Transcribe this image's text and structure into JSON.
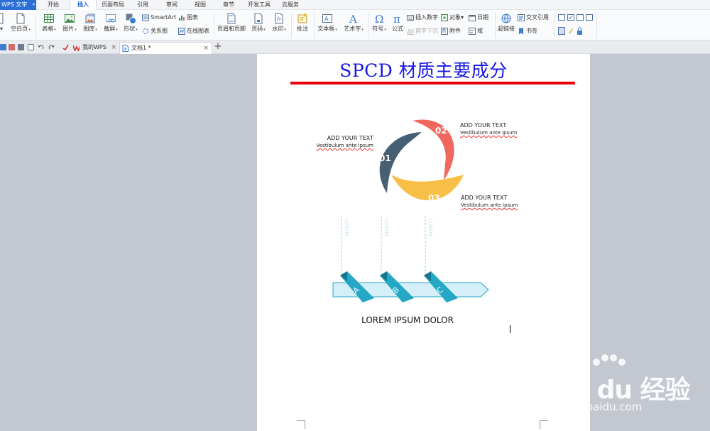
{
  "app": {
    "name": "WPS 文字",
    "menu_caret": "▾"
  },
  "menu": {
    "tabs": [
      {
        "label": "开始"
      },
      {
        "label": "插入"
      },
      {
        "label": "页面布局"
      },
      {
        "label": "引用"
      },
      {
        "label": "审阅"
      },
      {
        "label": "视图"
      },
      {
        "label": "章节"
      },
      {
        "label": "开发工具"
      },
      {
        "label": "云服务"
      }
    ]
  },
  "ribbon": {
    "blank_page": "空白页",
    "table": "表格",
    "picture": "图片",
    "gallery": "图库",
    "screenshot": "截屏",
    "shapes": "形状",
    "smartart": "SmartArt",
    "chart": "图表",
    "relationship": "关系图",
    "online_chart": "在线图表",
    "header_footer": "页眉和页脚",
    "page_number": "页码",
    "watermark": "水印",
    "comment": "批注",
    "textbox": "文本框",
    "wordart": "艺术字",
    "symbol": "符号",
    "formula": "公式",
    "insert_number": "插入数字",
    "drop_cap": "首字下沉",
    "object": "对象",
    "attachment": "附件",
    "date": "日期",
    "field": "域",
    "hyperlink": "超链接",
    "cross_ref": "交叉引用",
    "bookmark": "书签",
    "caret": "▾"
  },
  "tabs": {
    "items": [
      {
        "label": "我的WPS",
        "close": "×"
      },
      {
        "label": "文档1 *",
        "close": "×"
      }
    ],
    "add": "+"
  },
  "document": {
    "title": "SPCD 材质主要成分",
    "title_color": "#1717e8",
    "rule_color": "#e8000b",
    "cycle": {
      "colors": {
        "seg1": "#465f73",
        "seg2": "#f0675d",
        "seg3": "#f8bf47"
      },
      "segments": [
        {
          "number": "01",
          "heading": "ADD YOUR TEXT",
          "body": "Vestibulum ante ipsum"
        },
        {
          "number": "02",
          "heading": "ADD YOUR TEXT",
          "body": "Vestibulum ante ipsum"
        },
        {
          "number": "03",
          "heading": "ADD YOUR TEXT",
          "body": "Vestibulum ante ipsum"
        }
      ]
    },
    "ribbon_diagram": {
      "accent": "#24a8c6",
      "bar_fill": "#d4eff7",
      "markers": [
        {
          "letter": "A",
          "label": "LOREM"
        },
        {
          "letter": "B",
          "label": "LOREM"
        },
        {
          "letter": "C",
          "label": "LOREM"
        }
      ],
      "caption": "LOREM IPSUM DOLOR"
    }
  },
  "watermark": {
    "text": "Bai du 经验",
    "url": "jingyan.baidu.com"
  }
}
